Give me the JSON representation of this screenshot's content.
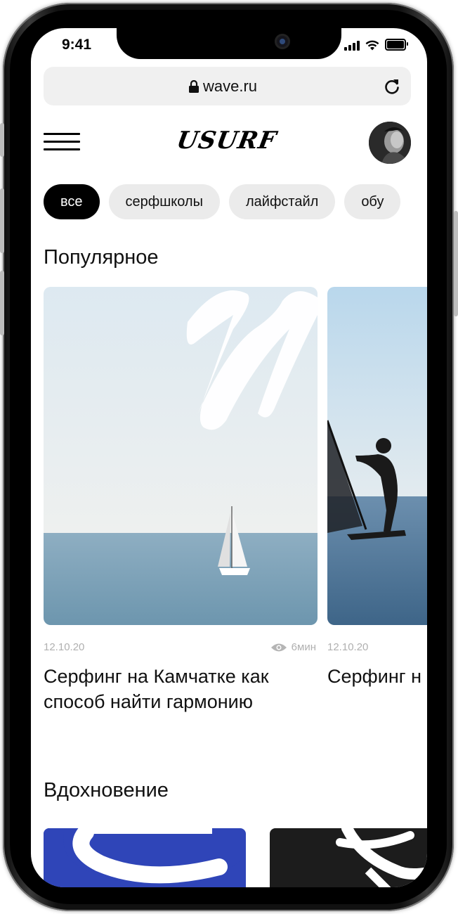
{
  "status_bar": {
    "time": "9:41"
  },
  "browser": {
    "url": "wave.ru"
  },
  "header": {
    "logo": "USURF"
  },
  "chips": [
    "все",
    "серфшколы",
    "лайфстайл",
    "обу"
  ],
  "sections": {
    "popular": "Популярное",
    "inspiration": "Вдохновение"
  },
  "cards": [
    {
      "date": "12.10.20",
      "read_time": "6мин",
      "title": "Серфинг на Камчатке как способ найти гармонию"
    },
    {
      "date": "12.10.20",
      "title": "Серфинг н способ на"
    }
  ],
  "colors": {
    "accent": "#000000",
    "chip_bg": "#ebebeb",
    "insp_blue": "#2f45b8",
    "insp_dark": "#1c1c1c"
  }
}
